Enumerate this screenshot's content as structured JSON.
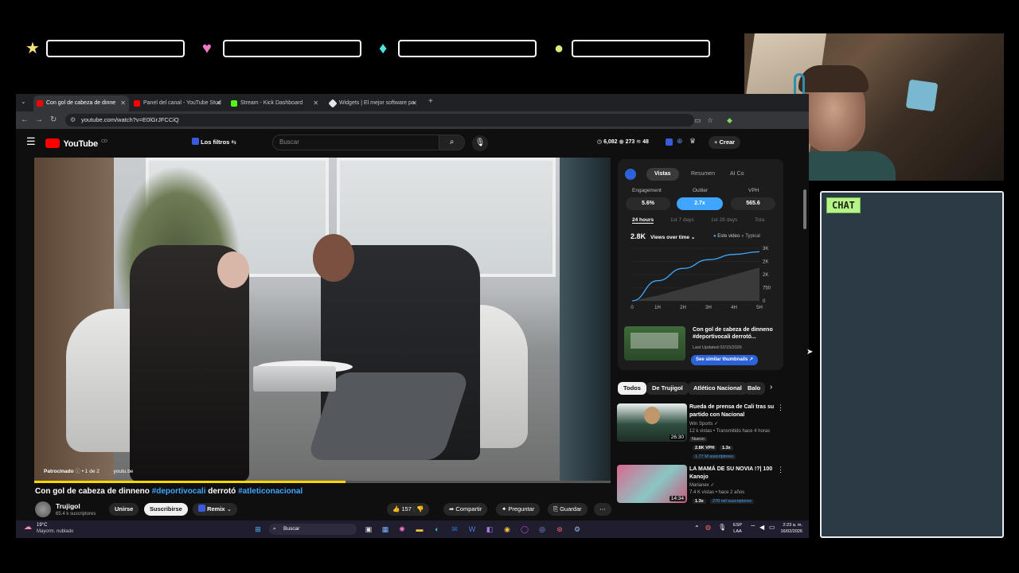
{
  "overlay": {
    "chat_label": "CHAT"
  },
  "browser": {
    "tabs": [
      {
        "label": "Con gol de cabeza de dinne",
        "active": true
      },
      {
        "label": "Panel del canal - YouTube Stud"
      },
      {
        "label": "Stream - Kick Dashboard"
      },
      {
        "label": "Widgets | El mejor software pa"
      }
    ],
    "url": "youtube.com/watch?v=E0lGrJFCCiQ"
  },
  "youtube": {
    "logo_text": "YouTube",
    "logo_sup": "CO",
    "filters_label": "Los filtros",
    "search_placeholder": "Buscar",
    "stats": {
      "a": "6,082",
      "b": "273",
      "c": "48"
    },
    "create_label": "Crear",
    "video": {
      "title_prefix": "Con gol de cabeza de dinneno ",
      "hashtag1": "#deportivocali",
      "title_mid": " derrotó ",
      "hashtag2": "#atleticonacional",
      "sponsored": "Patrocinado",
      "sponsored_count": "1 de 2",
      "sponsor_domain": "youtu.be",
      "progress_pct": 54
    },
    "channel": {
      "name": "Trujigol",
      "subs": "65.4 k suscriptores",
      "join_label": "Unirse",
      "subscribe_label": "Suscribirse",
      "remix_label": "Remix"
    },
    "actions": {
      "likes": "157",
      "share": "Compartir",
      "ask": "Preguntar",
      "save": "Guardar"
    }
  },
  "panel": {
    "tabs": [
      "Vistas",
      "Resumen",
      "AI Co"
    ],
    "metrics": [
      {
        "label": "Engagement",
        "value": "5.6%"
      },
      {
        "label": "Outlier",
        "value": "2.7x"
      },
      {
        "label": "VPH",
        "value": "565.6"
      }
    ],
    "ranges": [
      "24 hours",
      "1st 7 days",
      "1st 28 days",
      "Tota"
    ],
    "views_total": "2.8K",
    "views_mode": "Views over time",
    "legend_this": "Este video",
    "legend_typical": "Typical",
    "featured_title": "Con gol de cabeza de dinneno #deportivocali derrotó...",
    "featured_updated": "Last Updated 02/15/2026",
    "similar_btn": "See similar thumbnails"
  },
  "chart_data": {
    "type": "area",
    "x": [
      "0",
      "1H",
      "2H",
      "3H",
      "4H",
      "5H"
    ],
    "y_ticks": [
      "3K",
      "2K",
      "2K",
      "750",
      "0"
    ],
    "series": [
      {
        "name": "Este video",
        "values": [
          0,
          1150,
          1850,
          2350,
          2650,
          2800
        ]
      },
      {
        "name": "Typical",
        "values": [
          0,
          300,
          700,
          1100,
          1500,
          1900
        ]
      }
    ],
    "ylim": [
      0,
      3000
    ],
    "legend": "top-right"
  },
  "chips": [
    "Todos",
    "De Trujigol",
    "Atlético Nacional",
    "Balo"
  ],
  "suggestions": [
    {
      "title": "Rueda de prensa de Cali tras su partido con Nacional",
      "channel": "Win Sports",
      "meta": "12 k vistas • Transmitido hace 4 horas",
      "badge": "Nuevo",
      "vph": "2.8K VPH",
      "mult": "1.3x",
      "subs": "1.77 M suscriptores",
      "duration": "26:30"
    },
    {
      "title": "LA MAMÁ DE SU NOVIA !?| 100 Kanojo",
      "channel": "Marianex",
      "meta": "7.4 K vistas • hace 2 años",
      "mult": "1.3x",
      "subs": "270 mil suscriptores",
      "duration": "14:34"
    }
  ],
  "taskbar": {
    "weather_temp": "19°C",
    "weather_desc": "Mayorm. nublado",
    "search": "Buscar",
    "lang1": "ESP",
    "lang2": "LAA",
    "time": "2:23 a. m.",
    "date": "16/02/2026"
  },
  "colors": {
    "accent_blue": "#3ea6ff",
    "chat_bg": "#2c3a45",
    "chat_label_bg": "#b7f28a"
  }
}
